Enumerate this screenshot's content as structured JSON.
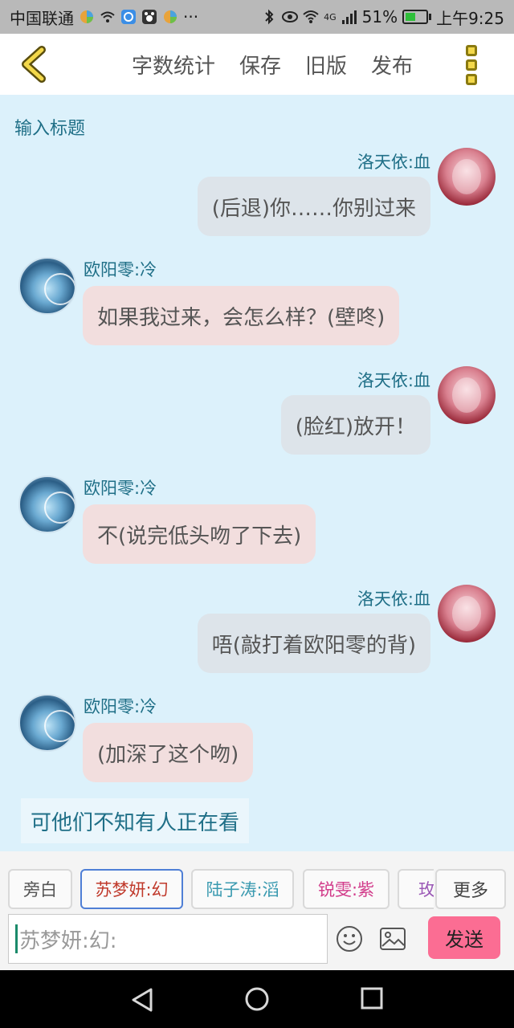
{
  "status_bar": {
    "carrier": "中国联通",
    "network": "4G",
    "battery": "51%",
    "time": "上午9:25",
    "battery_level": 0.51
  },
  "toolbar": {
    "actions": [
      "字数统计",
      "保存",
      "旧版",
      "发布"
    ]
  },
  "chat": {
    "title_placeholder": "输入标题",
    "messages": [
      {
        "side": "right",
        "name": "洛天依:血",
        "text": "(后退)你……你别过来"
      },
      {
        "side": "left",
        "name": "欧阳零:冷",
        "text": "如果我过来，会怎么样？(壁咚)"
      },
      {
        "side": "right",
        "name": "洛天依:血",
        "text": "(脸红)放开！"
      },
      {
        "side": "left",
        "name": "欧阳零:冷",
        "text": "不(说完低头吻了下去)"
      },
      {
        "side": "right",
        "name": "洛天依:血",
        "text": "唔(敲打着欧阳零的背)"
      },
      {
        "side": "left",
        "name": "欧阳零:冷",
        "text": "(加深了这个吻)"
      }
    ],
    "narration": "可他们不知有人正在看"
  },
  "input_panel": {
    "role_chips": [
      {
        "label": "旁白",
        "color": "#555555",
        "selected": false
      },
      {
        "label": "苏梦妍:幻",
        "color": "#c0392b",
        "selected": true
      },
      {
        "label": "陆子涛:滔",
        "color": "#3a9ab0",
        "selected": false
      },
      {
        "label": "锐雯:紫",
        "color": "#d23b8a",
        "selected": false
      },
      {
        "label": "玫:",
        "color": "#9b59b6",
        "selected": false
      }
    ],
    "more_label": "更多",
    "input_placeholder": "苏梦妍:幻:",
    "send_label": "发送"
  }
}
